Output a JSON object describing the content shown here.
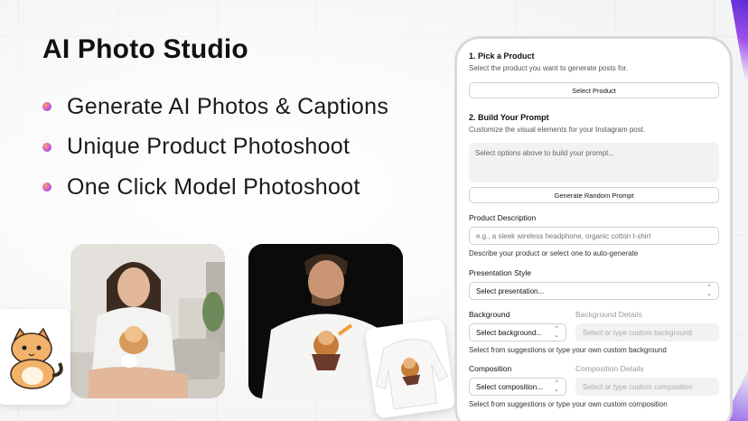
{
  "hero": {
    "title": "AI Photo Studio",
    "features": [
      "Generate AI Photos & Captions",
      "Unique Product Photoshoot",
      "One Click Model Photoshoot"
    ]
  },
  "form": {
    "step1": {
      "title": "1. Pick a Product",
      "description": "Select the product you want to generate posts for.",
      "button": "Select Product"
    },
    "step2": {
      "title": "2. Build Your Prompt",
      "description": "Customize the visual elements for your Instagram post.",
      "prompt_placeholder": "Select options above to build your prompt...",
      "random_button": "Generate Random Prompt"
    },
    "product_description": {
      "label": "Product Description",
      "placeholder": "e.g., a sleek wireless headphone, organic cotton t-shirt",
      "helper": "Describe your product or select one to auto-generate"
    },
    "presentation_style": {
      "label": "Presentation Style",
      "value": "Select presentation..."
    },
    "background": {
      "label": "Background",
      "value": "Select background...",
      "details_label": "Background Details",
      "details_placeholder": "Select or type custom background",
      "helper": "Select from suggestions or type your own custom background"
    },
    "composition": {
      "label": "Composition",
      "value": "Select composition...",
      "details_label": "Composition Details",
      "details_placeholder": "Select or type custom composition",
      "helper": "Select from suggestions or type your own custom composition"
    }
  },
  "colors": {
    "accent_purple": "#6a3fd8",
    "accent_orange": "#ff9d6a"
  },
  "icons": [
    "chevron-updown-icon",
    "cat-sticker",
    "sweater-sticker"
  ]
}
